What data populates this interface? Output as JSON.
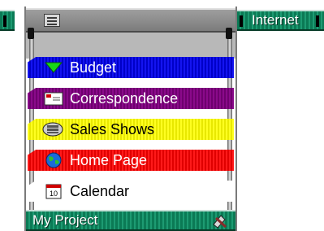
{
  "window": {
    "menu_icon": "list-icon"
  },
  "internet_bar": {
    "label": "Internet"
  },
  "tabs": [
    {
      "label": "Budget",
      "icon": "triangle-down-icon",
      "color": "#0000c8"
    },
    {
      "label": "Correspondence",
      "icon": "envelope-icon",
      "color": "#7a007a"
    },
    {
      "label": "Sales Shows",
      "icon": "document-stack-icon",
      "color": "#ffff00"
    },
    {
      "label": "Home Page",
      "icon": "globe-icon",
      "color": "#ff0000"
    },
    {
      "label": "Calendar",
      "icon": "calendar-icon",
      "color": "#ffffff"
    }
  ],
  "calendar_icon_day": "10",
  "status_bar": {
    "label": "My Project",
    "icon": "tools-icon"
  }
}
